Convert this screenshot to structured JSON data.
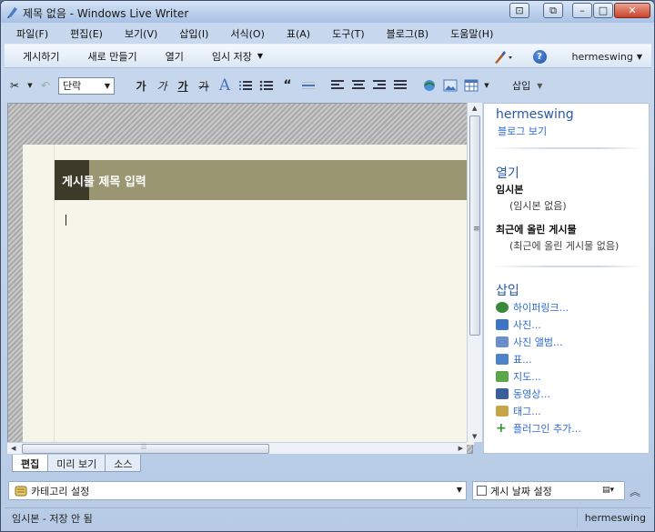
{
  "window": {
    "title": "제목 없음 - Windows Live Writer",
    "controls": {
      "restore": "⧉",
      "minimize": "–",
      "maximize": "□",
      "close": "✕",
      "extra": "⊡"
    }
  },
  "menu": [
    "파일(F)",
    "편집(E)",
    "보기(V)",
    "삽입(I)",
    "서식(O)",
    "표(A)",
    "도구(T)",
    "블로그(B)",
    "도움말(H)"
  ],
  "command_bar": {
    "publish": "게시하기",
    "new": "새로 만들기",
    "open": "열기",
    "save_draft": "임시 저장",
    "help_symbol": "?",
    "account": "hermeswing"
  },
  "format_bar": {
    "paragraph_style": "단락",
    "bold": "가",
    "italic": "가",
    "underline": "가",
    "strike": "가",
    "font_color": "A",
    "insert_menu": "삽입"
  },
  "editor": {
    "title_placeholder": "게시물 제목 입력"
  },
  "sidebar": {
    "blog_name": "hermeswing",
    "view_blog": "블로그 보기",
    "open_heading": "열기",
    "drafts_label": "임시본",
    "drafts_empty": "(임시본 없음)",
    "recent_label": "최근에 올린 게시물",
    "recent_empty": "(최근에 올린 게시물 없음)",
    "insert_heading": "삽입",
    "insert_items": [
      {
        "label": "하이퍼링크...",
        "icon": "hyperlink-icon",
        "color": "#3b8a3b"
      },
      {
        "label": "사진...",
        "icon": "picture-icon",
        "color": "#3d74c4"
      },
      {
        "label": "사진 앨범...",
        "icon": "photo-album-icon",
        "color": "#6a8fc9"
      },
      {
        "label": "표...",
        "icon": "table-icon",
        "color": "#4e84c9"
      },
      {
        "label": "지도...",
        "icon": "map-icon",
        "color": "#5aa64a"
      },
      {
        "label": "동영상...",
        "icon": "video-icon",
        "color": "#3a5f9b"
      },
      {
        "label": "태그...",
        "icon": "tag-icon",
        "color": "#c9a54a"
      },
      {
        "label": "플러그인 추가...",
        "icon": "plus-icon",
        "color": "#2c9a2c"
      }
    ]
  },
  "tabs": [
    "편집",
    "미리 보기",
    "소스"
  ],
  "category": {
    "label": "카테고리 설정"
  },
  "publish_date": {
    "label": "게시 날짜 설정"
  },
  "status": {
    "left": "임시본 - 저장 안 됨",
    "right": "hermeswing"
  }
}
